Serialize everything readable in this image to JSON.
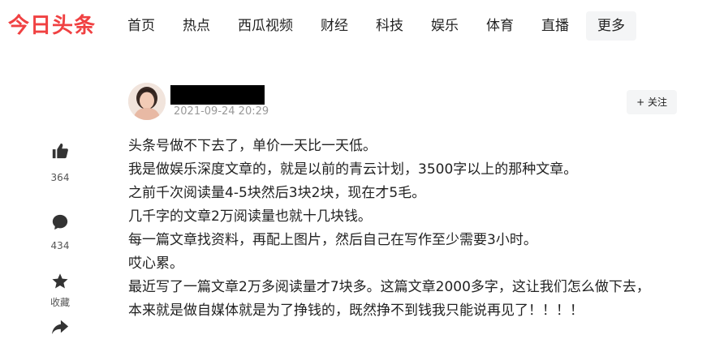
{
  "header": {
    "logo_text": "今日头条",
    "nav": [
      "首页",
      "热点",
      "西瓜视频",
      "财经",
      "科技",
      "娱乐",
      "体育",
      "直播"
    ],
    "more_label": "更多"
  },
  "author": {
    "post_time": "2021-09-24 20:29",
    "follow_label": "+ 关注"
  },
  "actions": {
    "like_count": "364",
    "comment_count": "434",
    "favorite_label": "收藏"
  },
  "article": {
    "paragraphs": [
      "头条号做不下去了，单价一天比一天低。",
      "我是做娱乐深度文章的，就是以前的青云计划，3500字以上的那种文章。",
      "之前千次阅读量4-5块然后3块2块，现在才5毛。",
      "几千字的文章2万阅读量也就十几块钱。",
      "每一篇文章找资料，再配上图片，然后自己在写作至少需要3小时。",
      "哎心累。",
      "最近写了一篇文章2万多阅读量才7块多。这篇文章2000多字，这让我们怎么做下去，",
      "本来就是做自媒体就是为了挣钱的，既然挣不到钱我只能说再见了！！！！"
    ]
  },
  "colors": {
    "brand": "#f04142",
    "icon": "#333333",
    "muted": "#999999"
  },
  "icons": [
    "thumbs-up-icon",
    "comment-icon",
    "star-icon",
    "share-icon"
  ]
}
